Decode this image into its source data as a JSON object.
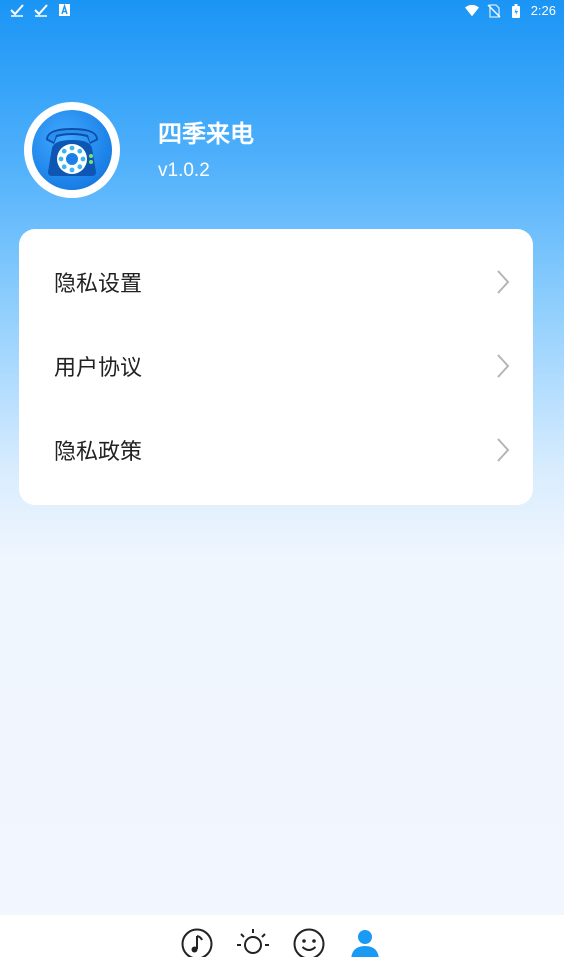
{
  "status_bar": {
    "time": "2:26",
    "left_icons": [
      "check-icon",
      "check-icon",
      "a-icon"
    ],
    "right_icons": [
      "wifi-icon",
      "no-sim-icon",
      "battery-icon"
    ]
  },
  "profile": {
    "app_name": "四季来电",
    "version": "v1.0.2",
    "avatar_icon": "rotary-phone-icon"
  },
  "menu": {
    "items": [
      {
        "label": "隐私设置",
        "icon": "chevron-right-icon"
      },
      {
        "label": "用户协议",
        "icon": "chevron-right-icon"
      },
      {
        "label": "隐私政策",
        "icon": "chevron-right-icon"
      }
    ]
  },
  "tab_bar": {
    "tabs": [
      {
        "icon": "music-note-icon",
        "active": false
      },
      {
        "icon": "sun-icon",
        "active": false
      },
      {
        "icon": "smiley-icon",
        "active": false
      },
      {
        "icon": "person-icon",
        "active": true
      }
    ],
    "active_color": "#1a9af5",
    "inactive_color": "#222222"
  },
  "colors": {
    "header_blue": "#1a95f5",
    "card_bg": "#ffffff",
    "page_bg": "#f2f6fe"
  }
}
